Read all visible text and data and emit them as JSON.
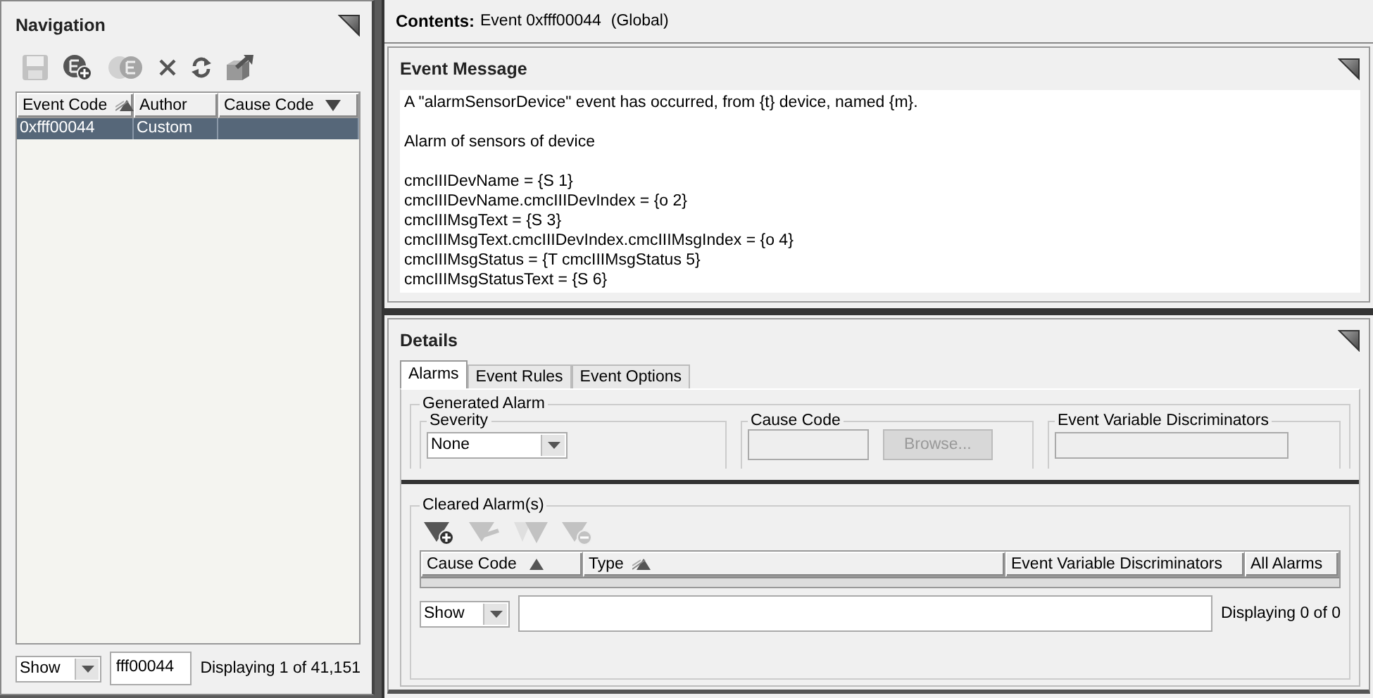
{
  "navigation": {
    "title": "Navigation",
    "toolbar": [
      {
        "kind": "save",
        "disabled": true
      },
      {
        "kind": "add-event",
        "disabled": false
      },
      {
        "kind": "duplicate-event",
        "disabled": true
      },
      {
        "kind": "delete",
        "disabled": false
      },
      {
        "kind": "refresh",
        "disabled": false
      },
      {
        "kind": "export",
        "disabled": false
      }
    ],
    "table": {
      "columns": [
        {
          "label": "Event Code",
          "ascending": true,
          "descending": false,
          "secondary": true
        },
        {
          "label": "Author",
          "ascending": false,
          "descending": false,
          "secondary": false
        },
        {
          "label": "Cause Code",
          "ascending": false,
          "descending": true,
          "secondary": false
        }
      ],
      "rows": [
        {
          "cells": [
            "0xfff00044",
            "Custom"
          ],
          "selected": true
        }
      ]
    },
    "footer": {
      "filter": "Show",
      "search_value": "fff00044",
      "status": "Displaying 1 of 41,151"
    }
  },
  "contents": {
    "label": "Contents:",
    "value": "Event 0xfff00044",
    "scope": "(Global)"
  },
  "event_message": {
    "title": "Event Message",
    "paragraphs": [
      [
        "A \"alarmSensorDevice\" event has occurred, from {t} device, named {m}."
      ],
      [
        "Alarm of sensors of device"
      ],
      [
        "cmcIIIDevName = {S 1}",
        "cmcIIIDevName.cmcIIIDevIndex = {o 2}",
        "cmcIIIMsgText = {S 3}",
        "cmcIIIMsgText.cmcIIIDevIndex.cmcIIIMsgIndex = {o 4}",
        "cmcIIIMsgStatus = {T cmcIIIMsgStatus 5}",
        "cmcIIIMsgStatusText = {S 6}"
      ]
    ]
  },
  "details": {
    "title": "Details",
    "tabs": [
      {
        "label": "Alarms",
        "selected": true
      },
      {
        "label": "Event Rules",
        "selected": false
      },
      {
        "label": "Event Options",
        "selected": false
      }
    ],
    "generated_alarm": {
      "legend": "Generated Alarm",
      "severity": {
        "legend": "Severity",
        "value": "None"
      },
      "cause_code": {
        "legend": "Cause Code",
        "button": "Browse...",
        "button_disabled": true
      },
      "discriminators": {
        "legend": "Event Variable Discriminators"
      }
    },
    "cleared_alarms": {
      "legend": "Cleared Alarm(s)",
      "toolbar": [
        {
          "kind": "add-filter",
          "disabled": false
        },
        {
          "kind": "edit-filter",
          "disabled": true
        },
        {
          "kind": "copy-filter",
          "disabled": true
        },
        {
          "kind": "remove-filter",
          "disabled": true
        }
      ],
      "columns": [
        {
          "label": "Cause Code",
          "ascending": true,
          "descending": false,
          "secondary": false
        },
        {
          "label": "Type",
          "ascending": true,
          "descending": false,
          "secondary": true
        },
        {
          "label": "Event Variable Discriminators",
          "ascending": false,
          "descending": false,
          "secondary": false
        },
        {
          "label": "All Alarms",
          "ascending": false,
          "descending": false,
          "secondary": false
        }
      ],
      "footer": {
        "filter": "Show",
        "status": "Displaying 0 of 0"
      }
    }
  }
}
